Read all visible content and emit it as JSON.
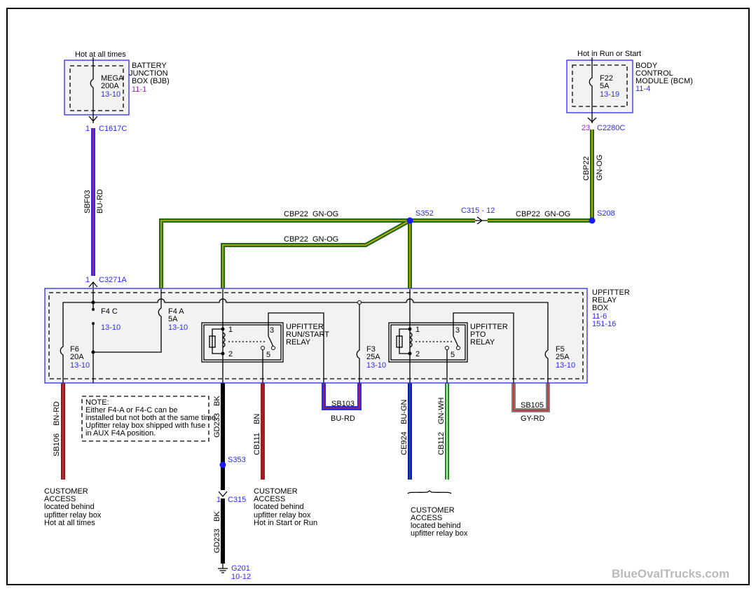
{
  "colors": {
    "frame": "#000000",
    "module_border": "#2a2af0",
    "module_fill": "#f2f2f2",
    "reference_text": "#2a2af0",
    "splice": "#1a1aff",
    "watermark": "#b8b8b8"
  },
  "wire_colors": {
    "GN-OG": [
      "#1d6b12",
      "#d2b000"
    ],
    "BU-RD": [
      "#2a2af0",
      "#c01818"
    ],
    "BN-RD": [
      "#8b1a1a",
      "#c03030"
    ],
    "BN": [
      "#9b2020",
      "#9b2020"
    ],
    "BK": [
      "#000000",
      "#000000"
    ],
    "BU-GN": [
      "#1010e0",
      "#208020"
    ],
    "GN-WH": [
      "#1e8a1e",
      "#ffffff"
    ],
    "GY-RD": [
      "#808080",
      "#e02020"
    ]
  },
  "bjb": {
    "supply": "Hot at all times",
    "name": [
      "BATTERY",
      "JUNCTION",
      "BOX (BJB)"
    ],
    "ref": "11-1",
    "fuse": "MEGA",
    "rating": "200A",
    "fuse_ref": "13-10",
    "pin": "1",
    "connector": "C1617C"
  },
  "bcm": {
    "supply": "Hot in Run or Start",
    "name": [
      "BODY",
      "CONTROL",
      "MODULE (BCM)"
    ],
    "ref": "11-4",
    "fuse": "F22",
    "rating": "5A",
    "fuse_ref": "13-19",
    "pin": "23",
    "connector": "C2280C"
  },
  "wires": {
    "sbf03": {
      "circuit": "SBF03",
      "color": "BU-RD"
    },
    "cbp22_vert": {
      "circuit": "CBP22",
      "color": "GN-OG"
    },
    "cbp22_top": "CBP22  GN-OG",
    "cbp22_mid": "CBP22  GN-OG",
    "cbp22_right": "CBP22  GN-OG",
    "sb106": {
      "circuit": "SB106",
      "color": "BN-RD"
    },
    "gd233_a": {
      "circuit": "GD233",
      "color": "BK"
    },
    "gd233_b": {
      "circuit": "GD233",
      "color": "BK"
    },
    "cb111": {
      "circuit": "CB111",
      "color": "BN"
    },
    "sb103": {
      "circuit": "SB103",
      "color": "BU-RD"
    },
    "ce924": {
      "circuit": "CE924",
      "color": "BU-GN"
    },
    "cb112": {
      "circuit": "CB112",
      "color": "GN-WH"
    },
    "sb105": {
      "circuit": "SB105",
      "color": "GY-RD"
    }
  },
  "connectors": {
    "c3271a_pin": "1",
    "c3271a": "C3271A",
    "c315_12": "C315 - 12",
    "c315_pin": "1",
    "c315": "C315"
  },
  "splices": {
    "s352": "S352",
    "s208": "S208",
    "s353": "S353"
  },
  "ground": {
    "name": "G201",
    "ref": "10-12"
  },
  "relay_box": {
    "name": [
      "UPFITTER",
      "RELAY",
      "BOX"
    ],
    "refs": [
      "11-6",
      "151-16"
    ],
    "fuses": [
      {
        "name": "F4 C",
        "rating": "",
        "ref": "13-10"
      },
      {
        "name": "F4 A",
        "rating": "5A",
        "ref": "13-10"
      },
      {
        "name": "F6",
        "rating": "20A",
        "ref": "13-10"
      },
      {
        "name": "F3",
        "rating": "25A",
        "ref": "13-10"
      },
      {
        "name": "F5",
        "rating": "25A",
        "ref": "13-10"
      }
    ],
    "relays": [
      {
        "name": [
          "UPFITTER",
          "RUN/START",
          "RELAY"
        ],
        "pins": [
          "1",
          "2",
          "3",
          "5"
        ]
      },
      {
        "name": [
          "UPFITTER",
          "PTO",
          "RELAY"
        ],
        "pins": [
          "1",
          "2",
          "3",
          "5"
        ]
      }
    ]
  },
  "note": [
    "NOTE:",
    "Either F4-A or F4-C can be",
    "installed but not both at the same time.",
    "Upfitter relay box shipped with fuse",
    "in AUX F4A position."
  ],
  "outputs": {
    "left": [
      "CUSTOMER",
      "ACCESS",
      "located behind",
      "upfitter relay box",
      "Hot at all times"
    ],
    "mid": [
      "CUSTOMER",
      "ACCESS",
      "located behind",
      "upfitter relay box",
      "Hot in Start or Run"
    ],
    "right": [
      "CUSTOMER",
      "ACCESS",
      "located behind",
      "upfitter relay box"
    ]
  },
  "watermark": "BlueOvalTrucks.com"
}
